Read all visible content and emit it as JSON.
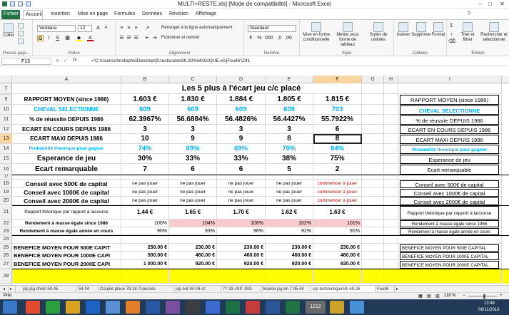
{
  "window": {
    "title": "MULTI+RESTE.xls]  [Mode de compatibilité] - Microsoft Excel",
    "minimize": "–",
    "restore": "□",
    "close": "✕"
  },
  "tabs": [
    "Fichier",
    "Accueil",
    "Insertion",
    "Mise en page",
    "Formules",
    "Données",
    "Révision",
    "Affichage"
  ],
  "ribbon": {
    "clipboard": {
      "label": "Presse-papi...",
      "paste": "Coller",
      "cut": "Couper",
      "copy": "Copier"
    },
    "font": {
      "label": "Police",
      "name": "Verdana",
      "size": "12",
      "bold": "G",
      "italic": "I",
      "underline": "S"
    },
    "alignment": {
      "label": "Alignement",
      "wrap": "Renvoyer à la ligne automatiquement",
      "merge": "Fusionner et centrer"
    },
    "number": {
      "label": "Nombre",
      "format": "Standard"
    },
    "styles": {
      "label": "Style",
      "cond": "Mise en forme conditionnelle",
      "table": "Mettre sous forme de tableau",
      "cell": "Styles de cellules"
    },
    "cells": {
      "label": "Cellules",
      "insert": "Insérer",
      "delete": "Supprimer",
      "format": "Format"
    },
    "editing": {
      "label": "Édition",
      "sort": "Trier et filtrer",
      "find": "Rechercher et sélectionner"
    }
  },
  "formula_bar": {
    "name_box": "F13",
    "fx": "fx",
    "formula": "='C:\\Users\\christophe\\Desktop\\[0.testscotes99.30%MAGIQUE.xls]Feuil6'!Z41"
  },
  "columns": [
    "A",
    "B",
    "C",
    "D",
    "E",
    "F",
    "G",
    "H",
    "I"
  ],
  "rows": [
    "7",
    "8",
    "9",
    "10",
    "11",
    "12",
    "13",
    "14",
    "15",
    "16",
    "17",
    "18",
    "19",
    "20",
    "21",
    "22",
    "23",
    "24",
    "25",
    "26",
    "27",
    "28"
  ],
  "title": "Les 5 plus à l'écart jeu c/c placé",
  "labels": {
    "r9": "RAPPORT MOYEN (since 1986)",
    "r10": "CHEVAL SELECTIONNE",
    "r11": "% de réussite  DEPUIS 1986",
    "r12": "ECART EN COURS DEPUIS 1986",
    "r13": "ECART MAXI DEPUIS 1986",
    "r14": "Probabilité theorique pour gagner",
    "r15": "Esperance de jeu",
    "r16": "Ecart remarquable",
    "r18": "Conseil avec 500€ de capital",
    "r19": "Conseil avec 1000€ de capital",
    "r20": "Conseil avec 2000€ de capital",
    "r21": "Rapport théorique par rapport à lacourse",
    "r22": "Rendement à masse égale since 1986",
    "r23": "Rendement à masse égale année en cours",
    "r25": "BENEFICE MOYEN POUR 500E CAPIT",
    "r26": "BENEFICE MOYEN POUR 1000E CAPI",
    "r27": "BENEFICE MOYEN POUR 2000E CAPI"
  },
  "right_labels": {
    "r9": "RAPPORT MOYEN (since 1986)",
    "r10": "CHEVAL SELECTIONNE",
    "r11": "% de réussite  DEPUIS 1986",
    "r12": "ECART EN COURS DEPUIS 1986",
    "r13": "ECART MAXI DEPUIS 1986",
    "r14": "Probabilité theorique pour gagner",
    "r15": "Esperance de jeu",
    "r16": "Ecart remarquable",
    "r18": "Conseil avec 500€ de capital",
    "r19": "Conseil avec 1000€ de capital",
    "r20": "Conseil avec 2000€ de capital",
    "r21": "Rapport théorique par rapport à lacourse",
    "r22": "Rendement à masse égale since 1986",
    "r23": "Rendement à masse égale année en cours",
    "r25": "BENEFICE MOYEN POUR 500E CAPITAL",
    "r26": "BENEFICE MOYEN POUR 1000E CAPITAL",
    "r27": "BENEFICE MOYEN POUR 2000E CAPITAL"
  },
  "data": {
    "r9": [
      "1.603 €",
      "1.830 €",
      "1.884 €",
      "1.805 €",
      "1.815 €"
    ],
    "r10": [
      "609",
      "609",
      "609",
      "609",
      "703"
    ],
    "r11": [
      "62.3967%",
      "56.6884%",
      "56.4826%",
      "56.4427%",
      "55.7922%"
    ],
    "r12": [
      "3",
      "3",
      "3",
      "3",
      "6"
    ],
    "r13": [
      "10",
      "9",
      "9",
      "8",
      "8"
    ],
    "r14": [
      "74%",
      "69%",
      "69%",
      "70%",
      "84%"
    ],
    "r15": [
      "30%",
      "33%",
      "33%",
      "38%",
      "75%"
    ],
    "r16": [
      "7",
      "6",
      "6",
      "5",
      "2"
    ],
    "r18": [
      "ne pas jouer",
      "ne pas jouer",
      "ne pas jouer",
      "ne pas jouer",
      "commencer à jouer"
    ],
    "r19": [
      "ne pas jouer",
      "ne pas jouer",
      "ne pas jouer",
      "ne pas jouer",
      "commencer à jouer"
    ],
    "r20": [
      "ne pas jouer",
      "ne pas jouer",
      "ne pas jouer",
      "ne pas jouer",
      "commencer à jouer"
    ],
    "r21": [
      "1.44 €",
      "1.65 €",
      "1.70 €",
      "1.62 €",
      "1.63 €"
    ],
    "r22": [
      "100%",
      "104%",
      "106%",
      "102%",
      "101%"
    ],
    "r23": [
      "90%",
      "93%",
      "96%",
      "92%",
      "91%"
    ],
    "r25": [
      "250.00 €",
      "230.00 €",
      "230.00 €",
      "230.00 €",
      "230.00 €"
    ],
    "r26": [
      "500.00 €",
      "460.00 €",
      "460.00 €",
      "460.00 €",
      "460.00 €"
    ],
    "r27": [
      "1 000.00 €",
      "920.00 €",
      "920.00 €",
      "920.00 €",
      "920.00 €"
    ]
  },
  "sheet_tabs": [
    "jsp jsg chsin 59.45",
    "54.04",
    "Couple place 78.18  7courses",
    "jsp out 94.04  cc",
    "77.33 JSP JSG",
    "bourse jsg en 7 95.44",
    "jsp technologieinfo 69.26",
    "Feuil6"
  ],
  "status": {
    "mode": "Prêt",
    "zoom": "118 %"
  },
  "taskbar": {
    "time": "13:46",
    "date": "06/11/2016",
    "badge": "1212"
  },
  "colors": {
    "excel_green": "#217346",
    "blue_text": "#00b0f0",
    "red_text": "#c00000",
    "pink_fill": "#f8c9cf",
    "yellow_fill": "#ffff00",
    "taskbar": "#213a57"
  }
}
